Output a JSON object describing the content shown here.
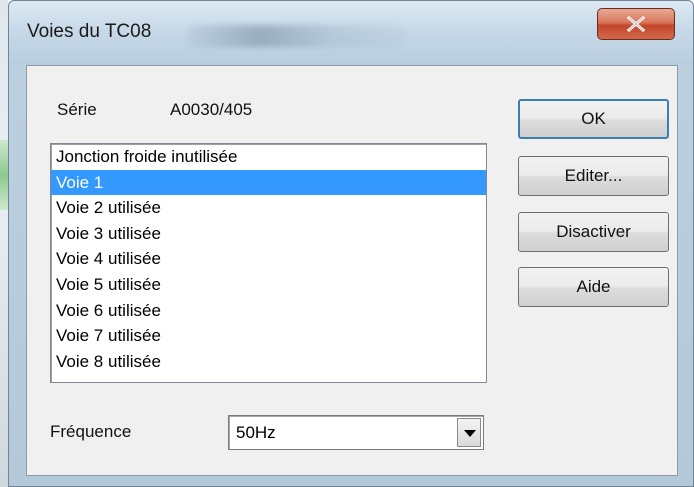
{
  "window": {
    "title": "Voies du TC08"
  },
  "serie": {
    "label": "Série",
    "value": "A0030/405"
  },
  "channels": [
    "Jonction froide inutilisée",
    "Voie 1",
    "Voie 2 utilisée",
    "Voie 3 utilisée",
    "Voie 4 utilisée",
    "Voie 5 utilisée",
    "Voie 6 utilisée",
    "Voie 7 utilisée",
    "Voie 8 utilisée"
  ],
  "selected_channel": "Voie 1",
  "buttons": {
    "ok": "OK",
    "edit": "Editer...",
    "deactivate": "Disactiver",
    "help": "Aide"
  },
  "frequency": {
    "label": "Fréquence",
    "value": "50Hz"
  },
  "icons": {
    "close": "close-icon",
    "dropdown": "chevron-down-icon"
  },
  "colors": {
    "selection": "#3399ff",
    "close_button": "#c4452a"
  }
}
